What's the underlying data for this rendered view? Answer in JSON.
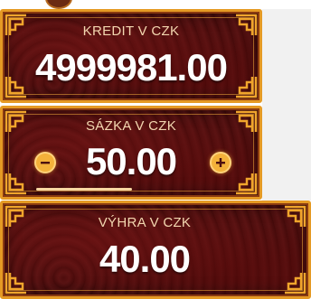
{
  "colors": {
    "panel_bg": "#4b0f0f",
    "gold_border": "#e59a24",
    "label": "#f3d7b0",
    "value": "#ffffff",
    "button": "#f3b13a"
  },
  "credit": {
    "label": "KREDIT V CZK",
    "value": "4999981.00"
  },
  "stake": {
    "label": "SÁZKA V CZK",
    "value": "50.00",
    "decrease_icon": "minus-icon",
    "increase_icon": "plus-icon"
  },
  "win": {
    "label": "VÝHRA V CZK",
    "value": "40.00"
  }
}
